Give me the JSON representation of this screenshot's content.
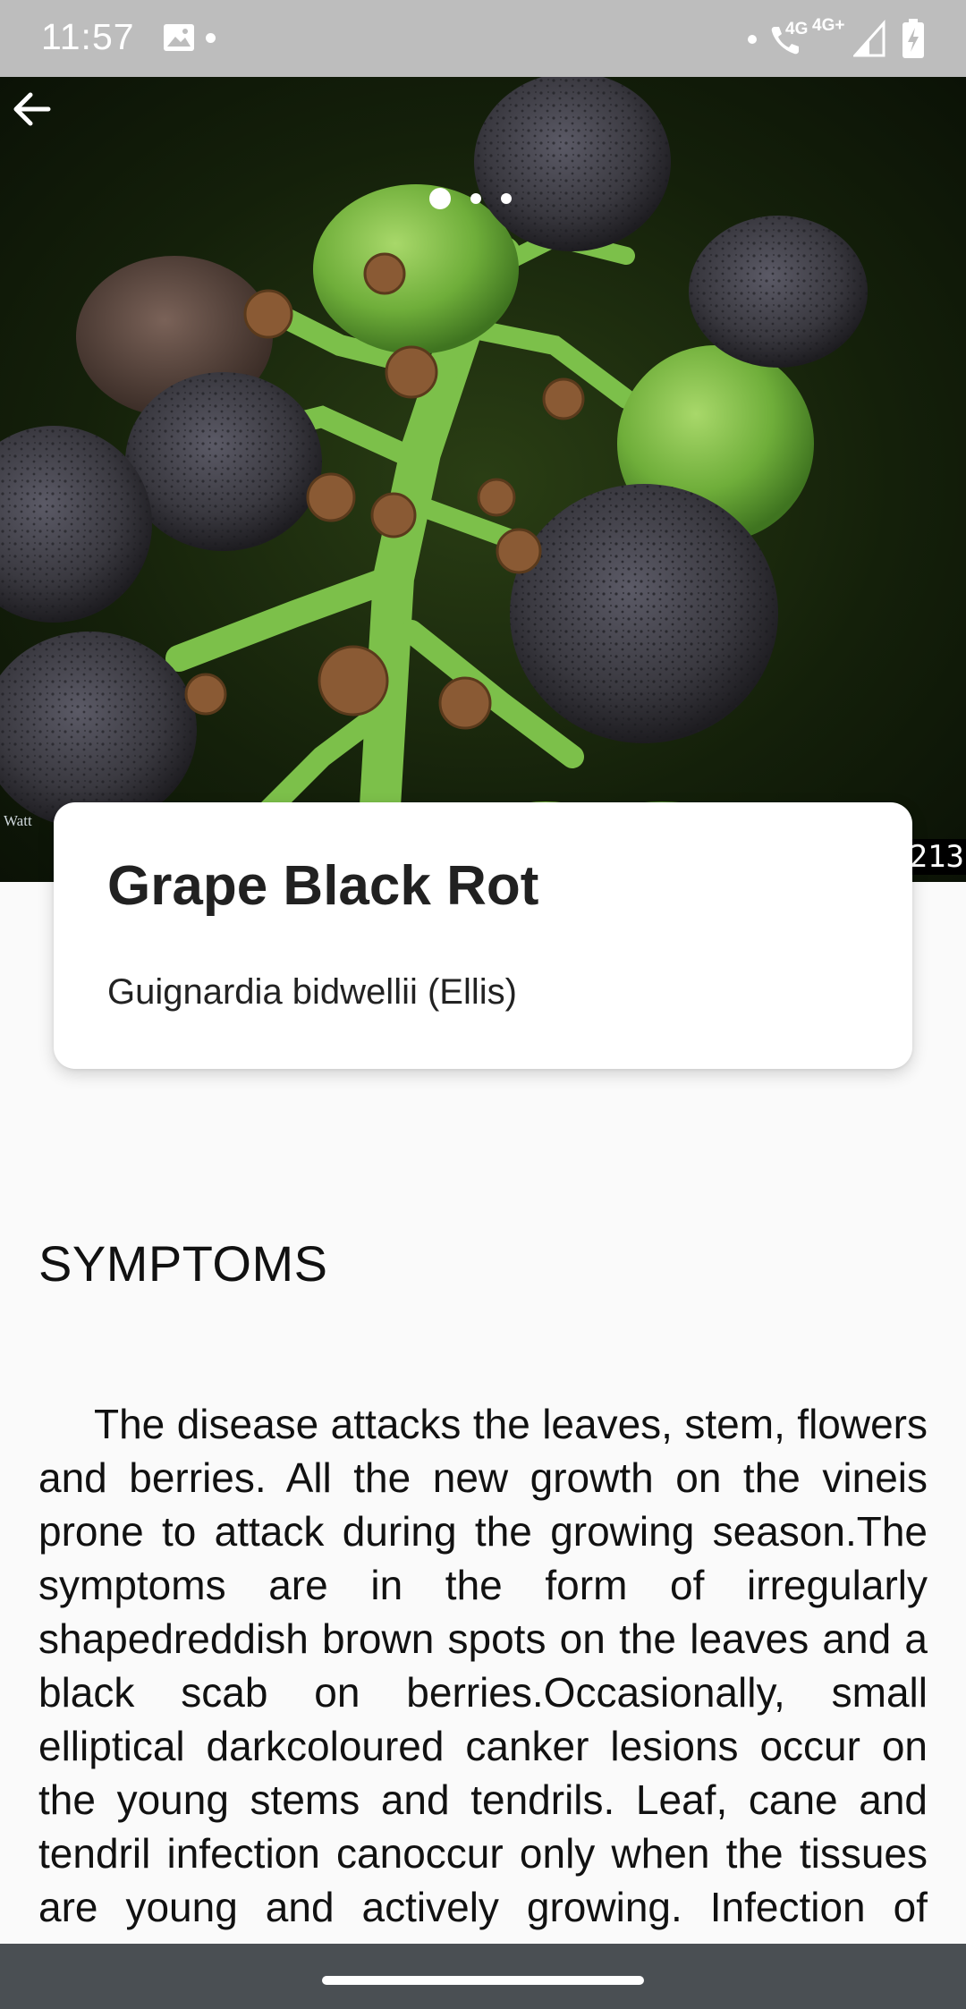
{
  "status_bar": {
    "time": "11:57",
    "network_label_1": "4G",
    "network_label_2": "4G+",
    "icons": [
      "image-icon",
      "dot-icon",
      "dot-icon",
      "phone-wifi-icon",
      "signal-icon",
      "battery-charging-icon"
    ]
  },
  "hero": {
    "carousel": {
      "count": 3,
      "active_index": 0
    },
    "watermark_left": "Watt",
    "watermark_right": "213",
    "back_icon": "arrow-left-icon"
  },
  "card": {
    "title": "Grape Black Rot",
    "subtitle": "Guignardia bidwellii (Ellis)"
  },
  "section": {
    "heading": "SYMPTOMS",
    "body": "The disease attacks the leaves, stem, flowers and berries. All the new growth on the vineis prone to attack during the growing season.The symptoms are in the form of irregularly shapedreddish brown spots on the leaves and a black scab on berries.Occasionally, small elliptical darkcoloured canker lesions occur on the young stems and tendrils. Leaf, cane and tendril infection canoccur only when the tissues are young and actively growing. Infection of berries may take place at any time until they begin to colour."
  },
  "colors": {
    "status_bar": "#bdbdbd",
    "background": "#fafafa",
    "card": "#ffffff",
    "nav_bar": "#4a4f53"
  }
}
